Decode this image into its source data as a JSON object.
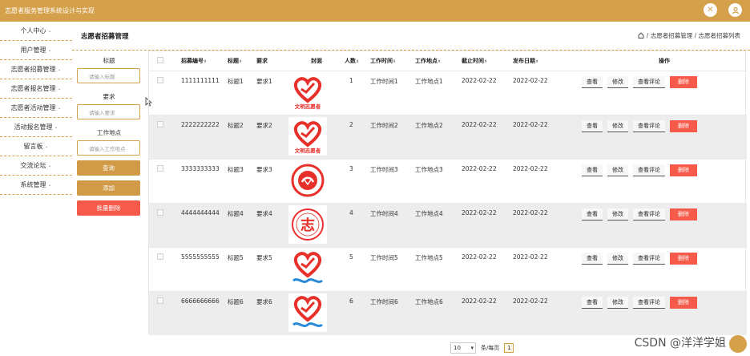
{
  "app": {
    "title": "志愿者服务管理系统设计与实现"
  },
  "sidebar": {
    "items": [
      {
        "label": "个人中心"
      },
      {
        "label": "用户管理"
      },
      {
        "label": "志愿者招募管理"
      },
      {
        "label": "志愿者报名管理"
      },
      {
        "label": "志愿者活动管理"
      },
      {
        "label": "活动报名管理"
      },
      {
        "label": "留言板"
      },
      {
        "label": "交流论坛"
      },
      {
        "label": "系统管理"
      }
    ]
  },
  "page": {
    "title": "志愿者招募管理",
    "breadcrumb": "/ 志愿者招募管理 / 志愿者招募列表"
  },
  "filter": {
    "title_label": "标题",
    "title_placeholder": "请输入标题",
    "req_label": "要求",
    "req_placeholder": "请输入要求",
    "place_label": "工作地点",
    "place_placeholder": "请输入工作地点",
    "query_btn": "查询",
    "add_btn": "添加",
    "batch_delete_btn": "批量删除"
  },
  "table": {
    "headers": {
      "code": "招募编号",
      "title": "标题",
      "req": "要求",
      "cover": "封面",
      "people": "人数",
      "time": "工作时间",
      "place": "工作地点",
      "deadline": "截止时间",
      "publish": "发布日期",
      "ops": "操作"
    },
    "op_labels": {
      "view": "查看",
      "edit": "修改",
      "comments": "查看评论",
      "delete": "删除"
    },
    "rows": [
      {
        "code": "1111111111",
        "title": "标题1",
        "req": "要求1",
        "people": "1",
        "time": "工作时间1",
        "place": "工作地点1",
        "deadline": "2022-02-22",
        "publish": "2022-02-22",
        "logo": "heart-text",
        "logo_text": "文明志愿者"
      },
      {
        "code": "2222222222",
        "title": "标题2",
        "req": "要求2",
        "people": "2",
        "time": "工作时间2",
        "place": "工作地点2",
        "deadline": "2022-02-22",
        "publish": "2022-02-22",
        "logo": "heart-text",
        "logo_text": "文明志愿者"
      },
      {
        "code": "3333333333",
        "title": "标题3",
        "req": "要求3",
        "people": "3",
        "time": "工作时间3",
        "place": "工作地点3",
        "deadline": "2022-02-22",
        "publish": "2022-02-22",
        "logo": "round-hands",
        "logo_text": ""
      },
      {
        "code": "4444444444",
        "title": "标题4",
        "req": "要求4",
        "people": "4",
        "time": "工作时间4",
        "place": "工作地点4",
        "deadline": "2022-02-22",
        "publish": "2022-02-22",
        "logo": "round-char",
        "logo_text": "志"
      },
      {
        "code": "5555555555",
        "title": "标题5",
        "req": "要求5",
        "people": "5",
        "time": "工作时间5",
        "place": "工作地点5",
        "deadline": "2022-02-22",
        "publish": "2022-02-22",
        "logo": "heart-wave",
        "logo_text": ""
      },
      {
        "code": "6666666666",
        "title": "标题6",
        "req": "要求6",
        "people": "6",
        "time": "工作时间6",
        "place": "工作地点6",
        "deadline": "2022-02-22",
        "publish": "2022-02-22",
        "logo": "heart-wave",
        "logo_text": ""
      }
    ]
  },
  "pager": {
    "page_size": "10",
    "per_page_label": "条/每页",
    "current_page": "1"
  },
  "watermark": "CSDN @洋洋学姐",
  "colors": {
    "accent": "#d4a04a",
    "danger": "#f55a4a"
  }
}
